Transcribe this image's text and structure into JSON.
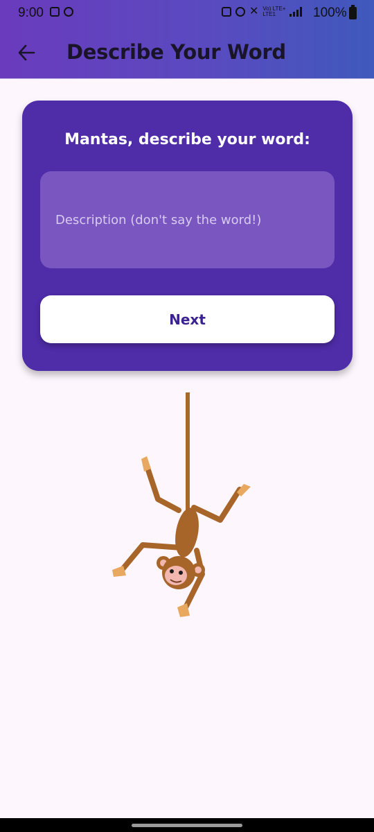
{
  "status_bar": {
    "time": "9:00",
    "network_label_top": "Vo) LTE+",
    "network_label_bottom": "LTE1",
    "battery": "100%"
  },
  "header": {
    "title": "Describe Your Word",
    "back_icon": "arrow-left-icon"
  },
  "card": {
    "heading": "Mantas, describe your word:",
    "description_placeholder": "Description (don't say the word!)",
    "description_value": "",
    "next_label": "Next"
  },
  "illustration": {
    "name": "hanging-monkey",
    "rope_color": "#a86a2a",
    "fur_color": "#a8652a",
    "hand_color": "#e8a860"
  },
  "colors": {
    "card_bg": "#4f2ca8",
    "field_bg": "#7a56c0",
    "button_text": "#3b2290",
    "page_bg": "#fdf6fd"
  }
}
